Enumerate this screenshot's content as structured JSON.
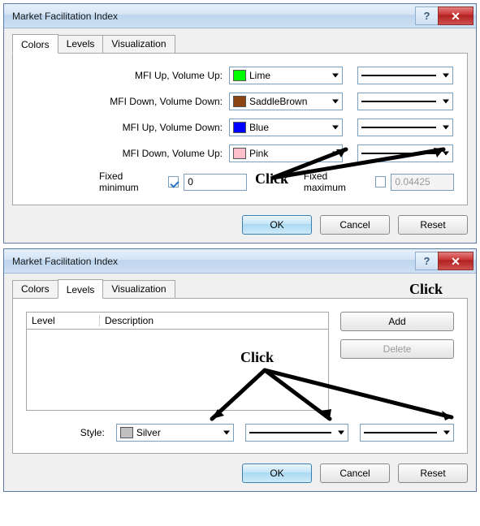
{
  "dialog1": {
    "title": "Market Facilitation Index",
    "tabs": {
      "colors": "Colors",
      "levels": "Levels",
      "visualization": "Visualization"
    },
    "rows": [
      {
        "label": "MFI Up, Volume Up:",
        "color_name": "Lime",
        "swatch": "#00ff00"
      },
      {
        "label": "MFI Down, Volume Down:",
        "color_name": "SaddleBrown",
        "swatch": "#8b4513"
      },
      {
        "label": "MFI Up, Volume Down:",
        "color_name": "Blue",
        "swatch": "#0000ff"
      },
      {
        "label": "MFI Down, Volume Up:",
        "color_name": "Pink",
        "swatch": "#ffc0cb"
      }
    ],
    "fixed_min_label": "Fixed minimum",
    "fixed_min_checked": true,
    "fixed_min_value": "0",
    "fixed_max_label": "Fixed maximum",
    "fixed_max_checked": false,
    "fixed_max_value": "0.04425",
    "buttons": {
      "ok": "OK",
      "cancel": "Cancel",
      "reset": "Reset"
    }
  },
  "dialog2": {
    "title": "Market Facilitation Index",
    "tabs": {
      "colors": "Colors",
      "levels": "Levels",
      "visualization": "Visualization"
    },
    "columns": {
      "level": "Level",
      "description": "Description"
    },
    "add": "Add",
    "delete": "Delete",
    "style_label": "Style:",
    "style_color_name": "Silver",
    "style_swatch": "#c0c0c0",
    "buttons": {
      "ok": "OK",
      "cancel": "Cancel",
      "reset": "Reset"
    }
  },
  "annotations": {
    "click": "Click"
  }
}
